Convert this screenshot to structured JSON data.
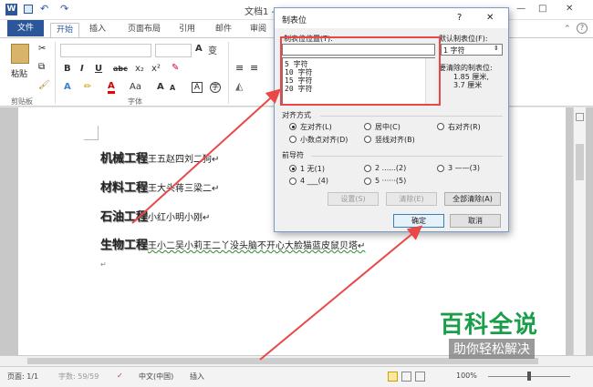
{
  "window": {
    "title": "文档1 - Microsoft Word",
    "help": "?",
    "minimize": "—",
    "maximize": "□",
    "close": "✕"
  },
  "tabs": {
    "file": "文件",
    "items": [
      "开始",
      "插入",
      "页面布局",
      "引用",
      "邮件",
      "审阅"
    ],
    "active": "开始"
  },
  "ribbon": {
    "paste": "粘贴",
    "clipboard": "剪贴板",
    "font_group": "字体",
    "bold": "B",
    "italic": "I",
    "underline": "U",
    "strike": "abc",
    "sub": "x₂",
    "sup": "x²",
    "wen": "变",
    "A_big": "A",
    "A_small": "A",
    "Aa": "Aa",
    "font_color": "A"
  },
  "document": {
    "lines": [
      {
        "head": "机械工程",
        "rest": "王五赵四刘二狗↵"
      },
      {
        "head": "材料工程",
        "rest": "王大头蒋三梁二↵"
      },
      {
        "head": "石油工程",
        "rest": "小红小明小刚↵"
      },
      {
        "head": "生物工程",
        "rest": "王小二吴小莉王二丫没头脑不开心大脸猫蓝皮鼠贝塔↵"
      }
    ],
    "empty_mark": "↵"
  },
  "status": {
    "page": "页面: 1/1",
    "words": "字数: 59/59",
    "lang": "中文(中国)",
    "mode": "插入",
    "zoom": "100%"
  },
  "dialog": {
    "title": "制表位",
    "help": "?",
    "close": "✕",
    "tab_pos_label": "制表位位置(T):",
    "tab_pos_value": "",
    "list_items": [
      "5 字符",
      "10 字符",
      "15 字符",
      "20 字符"
    ],
    "default_label": "默认制表位(F):",
    "default_value": "1 字符",
    "clear_label": "要清除的制表位:",
    "clear_values": [
      "1.85 厘米,",
      "3.7 厘米"
    ],
    "align_label": "对齐方式",
    "align_opts": [
      "左对齐(L)",
      "居中(C)",
      "右对齐(R)",
      "小数点对齐(D)",
      "竖线对齐(B)"
    ],
    "leader_label": "前导符",
    "leader_opts": [
      "1 无(1)",
      "2 ......(2)",
      "3 ——(3)",
      "4 ___(4)",
      "5 ······(5)"
    ],
    "set_btn": "设置(S)",
    "clear_btn": "清除(E)",
    "clearall_btn": "全部清除(A)",
    "ok_btn": "确定",
    "cancel_btn": "取消"
  },
  "watermark": {
    "title": "百科全说",
    "subtitle": "助你轻松解决"
  },
  "colors": {
    "accent": "#2b579a",
    "highlight": "#e84848",
    "watermark": "#1a9e4a"
  }
}
